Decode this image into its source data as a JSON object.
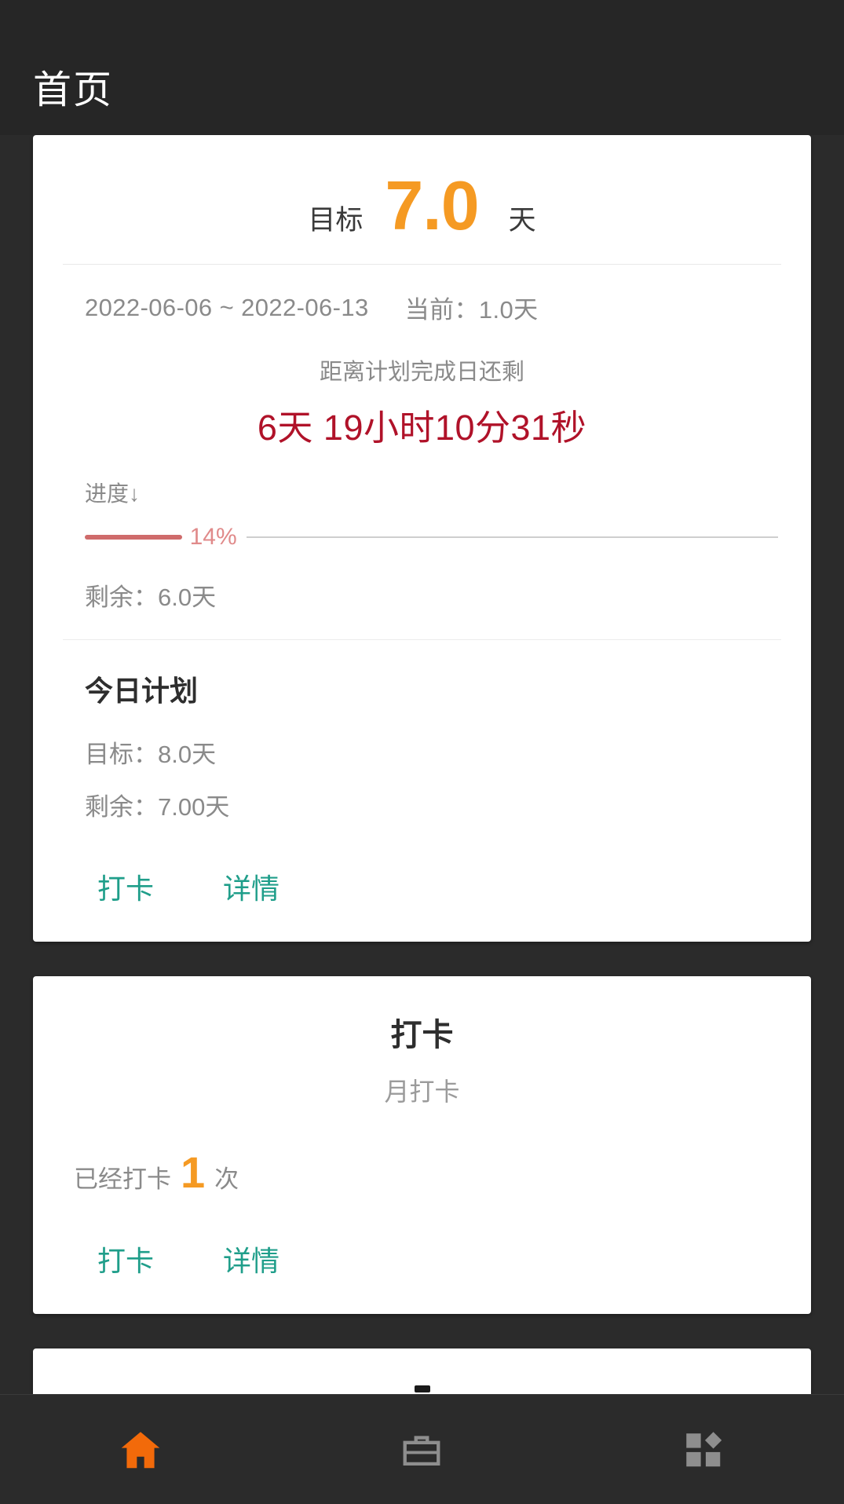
{
  "header": {
    "title": "首页"
  },
  "colors": {
    "accent_orange": "#f59a23",
    "accent_teal": "#1f9e8a",
    "countdown_red": "#b01229",
    "progress_red": "#cf6b6b",
    "background_dark": "#2b2b2b",
    "card_white": "#ffffff"
  },
  "plan_card": {
    "goal_label": "目标",
    "goal_value": "7.0",
    "goal_unit": "天",
    "date_range": "2022-06-06 ~ 2022-06-13",
    "current_label": "当前：1.0天",
    "countdown_caption": "距离计划完成日还剩",
    "countdown_value": "6天  19小时10分31秒",
    "progress_label": "进度↓",
    "progress_percent_text": "14%",
    "progress_percent": 14,
    "remaining_line": "剩余：6.0天",
    "today_title": "今日计划",
    "today_goal": "目标：8.0天",
    "today_remaining": "剩余：7.00天",
    "checkin_button": "打卡",
    "detail_button": "详情"
  },
  "checkin_card": {
    "title": "打卡",
    "subtitle": "月打卡",
    "count_prefix": "已经打卡",
    "count_value": "1",
    "count_suffix": "次",
    "checkin_button": "打卡",
    "detail_button": "详情"
  },
  "bottom_nav": {
    "items": [
      {
        "name": "home",
        "icon": "home-icon",
        "active": true
      },
      {
        "name": "briefcase",
        "icon": "briefcase-icon",
        "active": false
      },
      {
        "name": "apps",
        "icon": "apps-grid-icon",
        "active": false
      }
    ]
  }
}
